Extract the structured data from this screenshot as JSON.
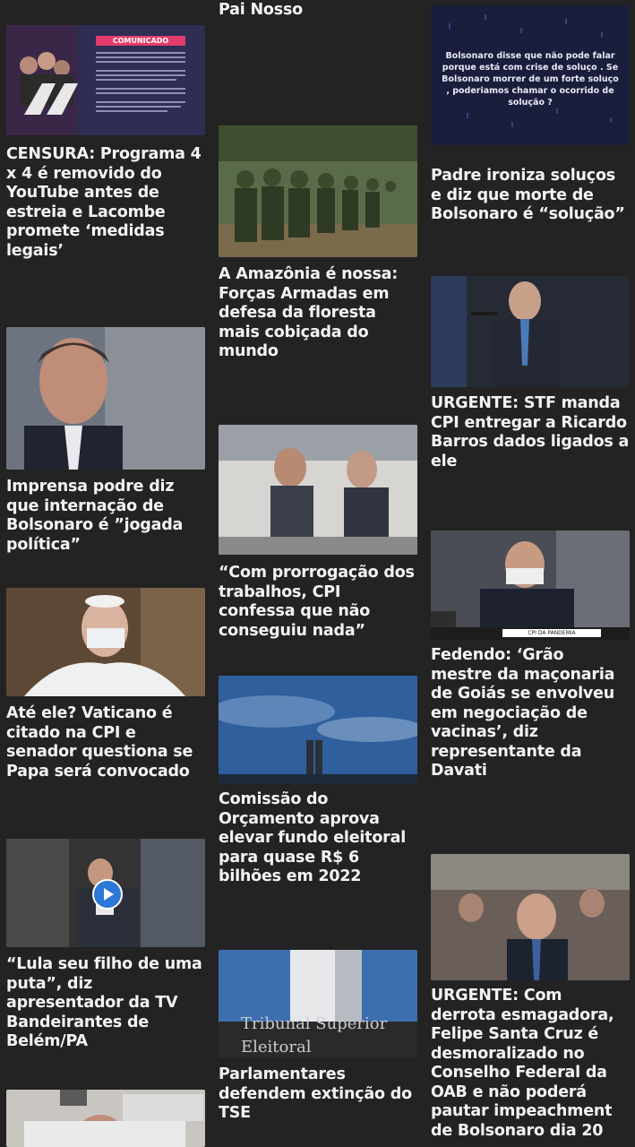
{
  "articles": [
    {
      "id": "a1",
      "title": "Pai Nosso"
    },
    {
      "id": "a2",
      "title": "CENSURA: Programa 4 x 4 é removido do YouTube antes de estreia e Lacombe promete ‘medidas legais’",
      "image_label": "COMUNICADO"
    },
    {
      "id": "a3",
      "title": "A Amazônia é nossa: Forças Armadas em defesa da floresta mais cobiçada do mundo"
    },
    {
      "id": "a4",
      "title": "Padre ironiza soluços e diz que morte de Bolsonaro é “solução”",
      "image_text": "Bolsonaro disse que não pode falar porque está com crise de soluço . Se Bolsonaro morrer de um forte soluço , poderiamos chamar o ocorrido de solução ?"
    },
    {
      "id": "a5",
      "title": "Imprensa podre diz que internação de Bolsonaro é ”jogada política”"
    },
    {
      "id": "a6",
      "title": "URGENTE: STF manda CPI entregar a Ricardo Barros dados ligados a ele"
    },
    {
      "id": "a7",
      "title": "“Com prorrogação dos trabalhos, CPI confessa que não conseguiu nada”"
    },
    {
      "id": "a8",
      "title": "Até ele? Vaticano é citado na CPI e senador questiona se Papa será convocado"
    },
    {
      "id": "a9",
      "title": "Fedendo: ‘Grão mestre da maçonaria de Goiás se envolveu em negociação de vacinas’, diz representante da Davati",
      "image_label": "CPI DA PANDEMIA"
    },
    {
      "id": "a10",
      "title": "Comissão do Orçamento aprova elevar fundo eleitoral para quase R$ 6 bilhões em 2022"
    },
    {
      "id": "a11",
      "title": "“Lula seu filho de uma puta”, diz apresentador da TV Bandeirantes de Belém/PA"
    },
    {
      "id": "a12",
      "title": "URGENTE: Com derrota esmagadora, Felipe Santa Cruz é desmoralizado no Conselho Federal da OAB e não poderá pautar impeachment de Bolsonaro dia 20"
    },
    {
      "id": "a13",
      "title": "Parlamentares defendem extinção do TSE",
      "image_text": "Tribunal Superior Eleitoral"
    }
  ],
  "colors": {
    "background": "#232323",
    "title": "#f3f3f3",
    "accent": "#2b78d6"
  }
}
